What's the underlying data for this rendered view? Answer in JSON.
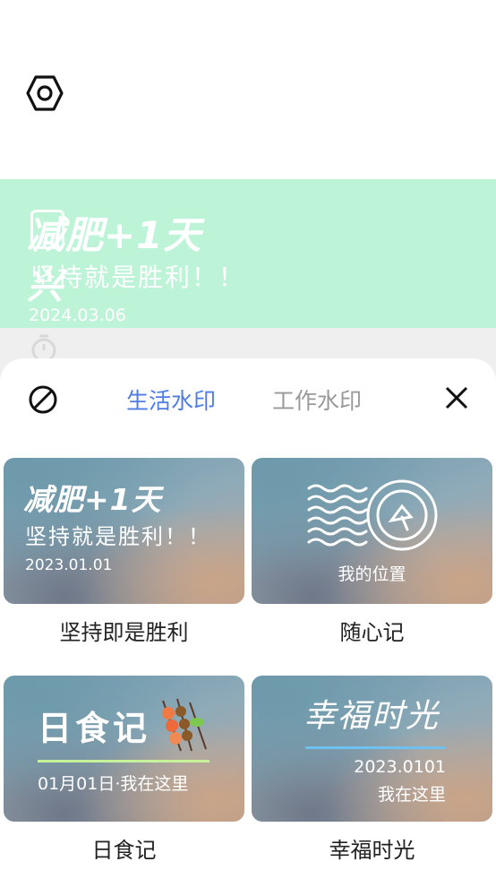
{
  "top": {
    "settings_icon": "gear-hexagon-icon"
  },
  "preview": {
    "title": "减肥+1天",
    "title_overlap": "兴",
    "subtitle": "坚持就是胜利！！",
    "date": "2024.03.06"
  },
  "sheet": {
    "none_icon": "prohibited-icon",
    "close_icon": "close-icon",
    "tabs": [
      {
        "label": "生活水印",
        "active": true
      },
      {
        "label": "工作水印",
        "active": false
      }
    ],
    "colors": {
      "active_tab": "#4f7de6",
      "inactive_tab": "#999999",
      "preview_bg": "#bdf4d8"
    }
  },
  "templates": [
    {
      "label": "坚持即是胜利",
      "title": "减肥+1天",
      "subtitle": "坚持就是胜利！！",
      "date": "2023.01.01"
    },
    {
      "label": "随心记",
      "location": "我的位置"
    },
    {
      "label": "日食记",
      "title": "日食记",
      "subtitle": "01月01日·我在这里"
    },
    {
      "label": "幸福时光",
      "title": "幸福时光",
      "date": "2023.0101",
      "location": "我在这里"
    }
  ]
}
